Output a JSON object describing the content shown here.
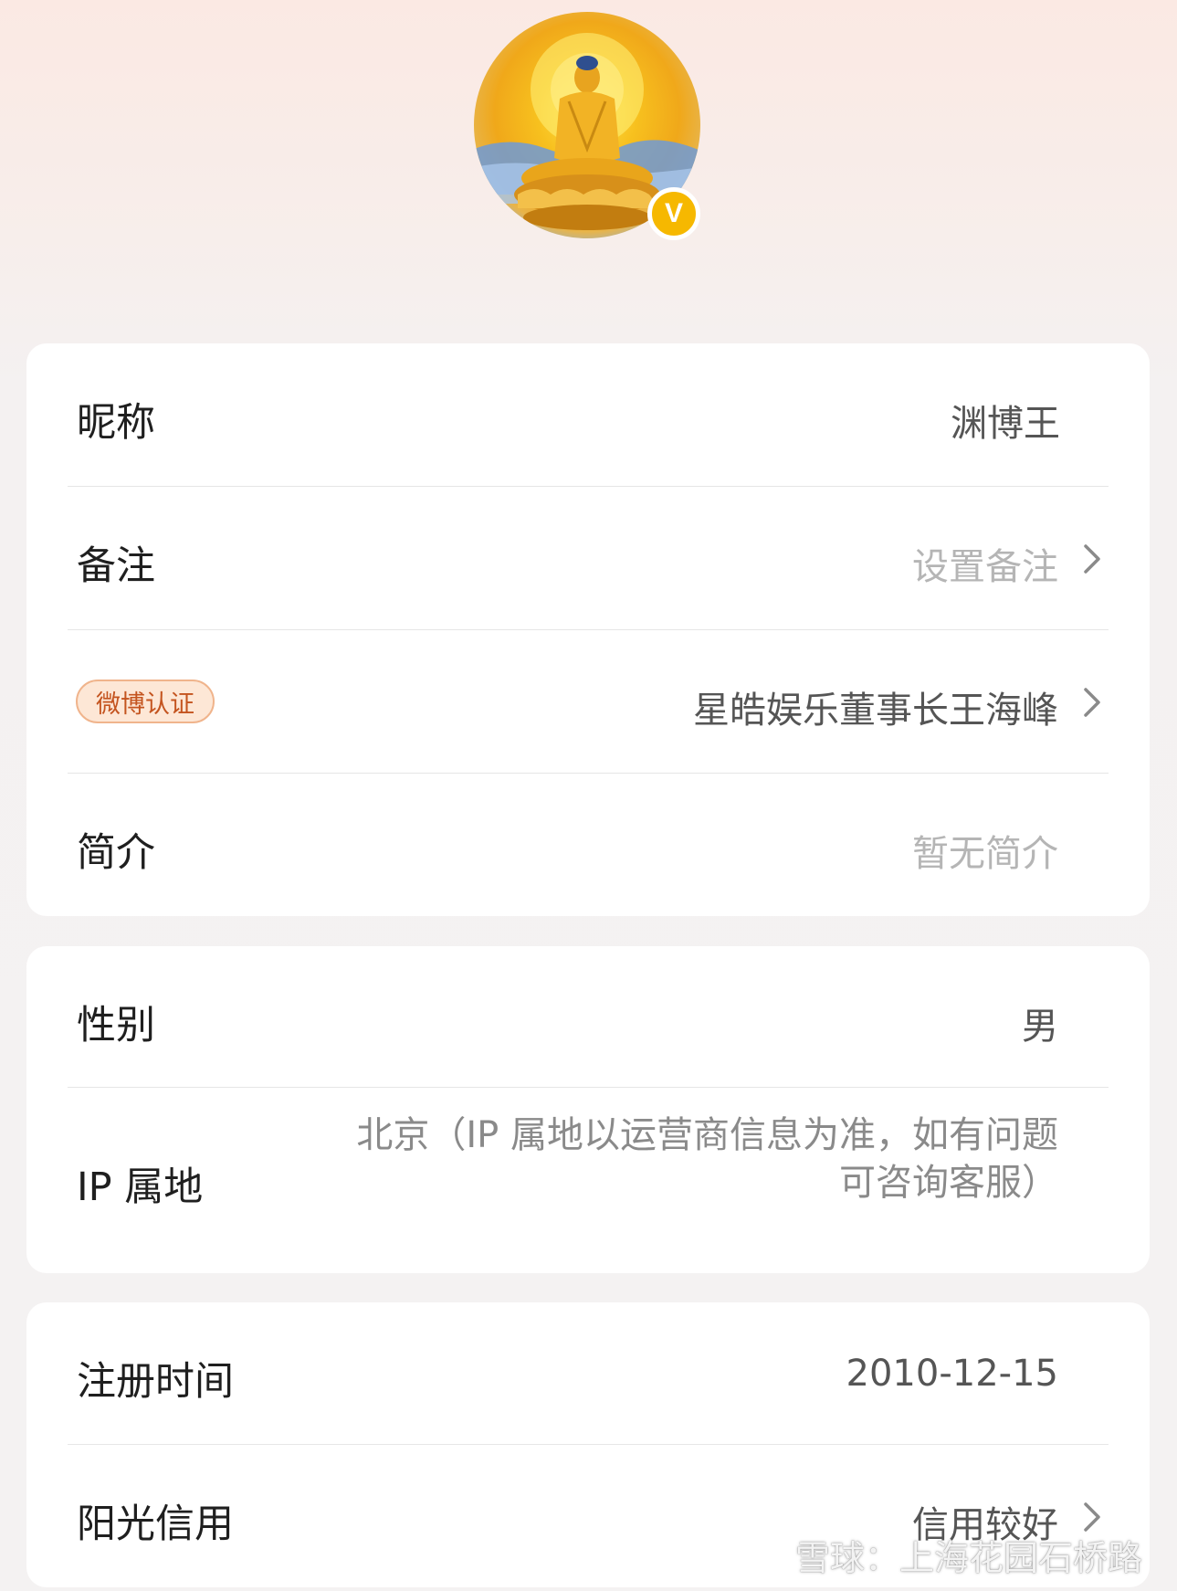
{
  "profile": {
    "avatar_icon": "buddha-avatar",
    "verified_badge": "V"
  },
  "card1": {
    "nickname_label": "昵称",
    "nickname_value": "渊博王",
    "remark_label": "备注",
    "remark_value": "设置备注",
    "cert_badge": "微博认证",
    "cert_value": "星皓娱乐董事长王海峰",
    "bio_label": "简介",
    "bio_value": "暂无简介"
  },
  "card2": {
    "gender_label": "性别",
    "gender_value": "男",
    "ip_label": "IP 属地",
    "ip_value_line1": "北京（IP 属地以运营商信息为准，如有问题",
    "ip_value_line2": "可咨询客服）"
  },
  "card3": {
    "reg_label": "注册时间",
    "reg_value": "2010-12-15",
    "credit_label": "阳光信用",
    "credit_value": "信用较好"
  },
  "watermark": {
    "text": "雪球：上海花园石桥路"
  },
  "colors": {
    "badge_bg": "#fde7d6",
    "badge_text": "#c4541f",
    "verified": "#f6b800"
  }
}
